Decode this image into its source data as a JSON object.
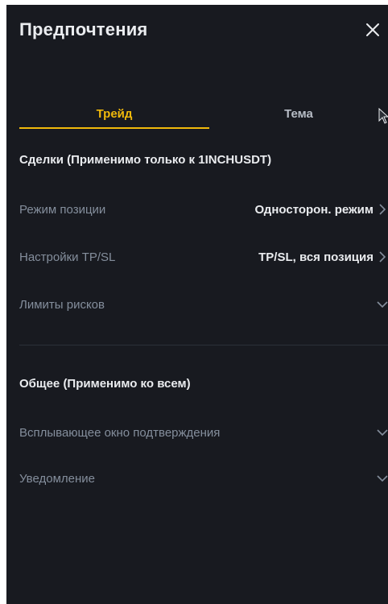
{
  "header": {
    "title": "Предпочтения",
    "close_icon": "close-icon"
  },
  "tabs": [
    {
      "label": "Трейд",
      "active": true
    },
    {
      "label": "Тема",
      "active": false
    }
  ],
  "trades_section": {
    "title": "Сделки (Применимо только к 1INCHUSDT)",
    "rows": [
      {
        "label": "Режим позиции",
        "value": "Односторон. режим",
        "icon": "chevron-right-icon"
      },
      {
        "label": "Настройки TP/SL",
        "value": "TP/SL, вся позиция",
        "icon": "chevron-right-icon"
      },
      {
        "label": "Лимиты рисков",
        "value": "",
        "icon": "chevron-down-icon"
      }
    ]
  },
  "general_section": {
    "title": "Общее (Применимо ко всем)",
    "rows": [
      {
        "label": "Всплывающее окно подтверждения",
        "icon": "chevron-down-icon"
      },
      {
        "label": "Уведомление",
        "icon": "chevron-down-icon"
      }
    ]
  },
  "colors": {
    "background": "#181a20",
    "accent": "#f0b90b",
    "text_primary": "#eaecef",
    "text_secondary": "#848e9c"
  }
}
